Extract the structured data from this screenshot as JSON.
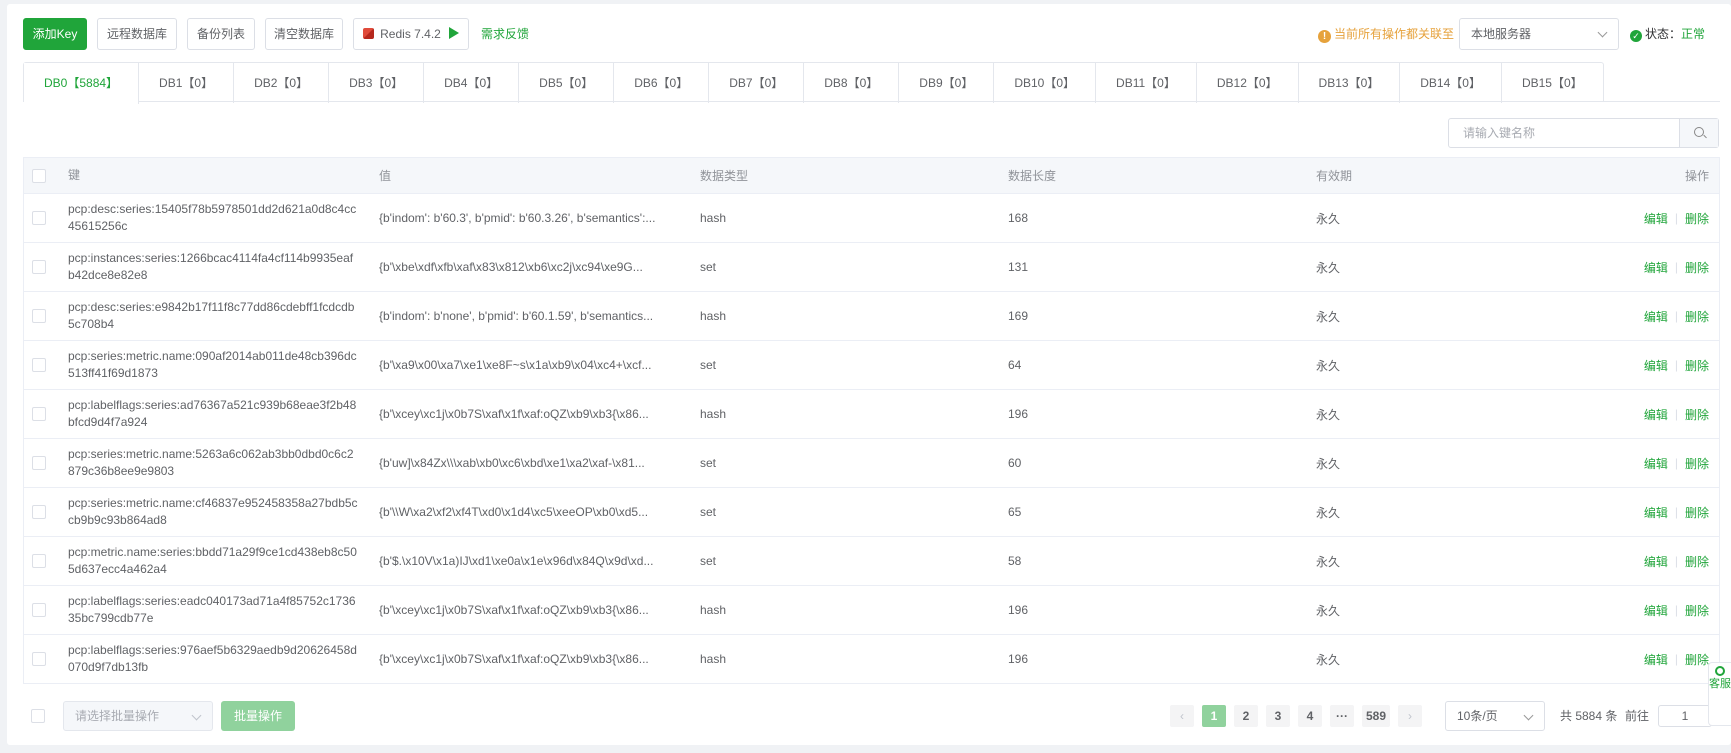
{
  "toolbar": {
    "add_key": "添加Key",
    "remote_db": "远程数据库",
    "backup_list": "备份列表",
    "clear_db": "清空数据库",
    "redis_version": "Redis 7.4.2",
    "feedback": "需求反馈",
    "warning": "当前所有操作都关联至",
    "server_select": "本地服务器",
    "status_label": "状态：",
    "status_value": "正常"
  },
  "tabs": [
    {
      "label": "DB0【5884】",
      "active": true
    },
    {
      "label": "DB1【0】"
    },
    {
      "label": "DB2【0】"
    },
    {
      "label": "DB3【0】"
    },
    {
      "label": "DB4【0】"
    },
    {
      "label": "DB5【0】"
    },
    {
      "label": "DB6【0】"
    },
    {
      "label": "DB7【0】"
    },
    {
      "label": "DB8【0】"
    },
    {
      "label": "DB9【0】"
    },
    {
      "label": "DB10【0】"
    },
    {
      "label": "DB11【0】"
    },
    {
      "label": "DB12【0】"
    },
    {
      "label": "DB13【0】"
    },
    {
      "label": "DB14【0】"
    },
    {
      "label": "DB15【0】"
    }
  ],
  "search": {
    "placeholder": "请输入键名称"
  },
  "table": {
    "headers": {
      "key": "键",
      "value": "值",
      "type": "数据类型",
      "length": "数据长度",
      "expiry": "有效期",
      "ops": "操作"
    },
    "edit_label": "编辑",
    "delete_label": "删除",
    "rows": [
      {
        "key": "pcp:desc:series:15405f78b5978501dd2d621a0d8c4cc45615256c",
        "value": "{b'indom': b'60.3', b'pmid': b'60.3.26', b'semantics':...",
        "type": "hash",
        "length": "168",
        "expiry": "永久"
      },
      {
        "key": "pcp:instances:series:1266bcac4114fa4cf114b9935eafb42dce8e82e8",
        "value": "{b'\\xbe\\xdf\\xfb\\xaf\\x83\\x812\\xb6\\xc2j\\xc94\\xe9G...",
        "type": "set",
        "length": "131",
        "expiry": "永久"
      },
      {
        "key": "pcp:desc:series:e9842b17f11f8c77dd86cdebff1fcdcdb5c708b4",
        "value": "{b'indom': b'none', b'pmid': b'60.1.59', b'semantics...",
        "type": "hash",
        "length": "169",
        "expiry": "永久"
      },
      {
        "key": "pcp:series:metric.name:090af2014ab011de48cb396dc513ff41f69d1873",
        "value": "{b'\\xa9\\x00\\xa7\\xe1\\xe8F~s\\x1a\\xb9\\x04\\xc4+\\xcf...",
        "type": "set",
        "length": "64",
        "expiry": "永久"
      },
      {
        "key": "pcp:labelflags:series:ad76367a521c939b68eae3f2b48bfcd9d4f7a924",
        "value": "{b'\\xcey\\xc1j\\x0b7S\\xaf\\x1f\\xaf:oQZ\\xb9\\xb3{\\x86...",
        "type": "hash",
        "length": "196",
        "expiry": "永久"
      },
      {
        "key": "pcp:series:metric.name:5263a6c062ab3bb0dbd0c6c2879c36b8ee9e9803",
        "value": "{b'uw]\\x84Zx\\\\\\xab\\xb0\\xc6\\xbd\\xe1\\xa2\\xaf-\\x81...",
        "type": "set",
        "length": "60",
        "expiry": "永久"
      },
      {
        "key": "pcp:series:metric.name:cf46837e952458358a27bdb5ccb9b9c93b864ad8",
        "value": "{b'\\\\W\\xa2\\xf2\\xf4T\\xd0\\x1d4\\xc5\\xeeOP\\xb0\\xd5...",
        "type": "set",
        "length": "65",
        "expiry": "永久"
      },
      {
        "key": "pcp:metric.name:series:bbdd71a29f9ce1cd438eb8c505d637ecc4a462a4",
        "value": "{b'$.\\x10V\\x1a)IJ\\xd1\\xe0a\\x1e\\x96d\\x84Q\\x9d\\xd...",
        "type": "set",
        "length": "58",
        "expiry": "永久"
      },
      {
        "key": "pcp:labelflags:series:eadc040173ad71a4f85752c173635bc799cdb77e",
        "value": "{b'\\xcey\\xc1j\\x0b7S\\xaf\\x1f\\xaf:oQZ\\xb9\\xb3{\\x86...",
        "type": "hash",
        "length": "196",
        "expiry": "永久"
      },
      {
        "key": "pcp:labelflags:series:976aef5b6329aedb9d20626458d070d9f7db13fb",
        "value": "{b'\\xcey\\xc1j\\x0b7S\\xaf\\x1f\\xaf:oQZ\\xb9\\xb3{\\x86...",
        "type": "hash",
        "length": "196",
        "expiry": "永久"
      }
    ]
  },
  "footer": {
    "batch_placeholder": "请选择批量操作",
    "batch_button": "批量操作",
    "pages": [
      "1",
      "2",
      "3",
      "4",
      "···",
      "589"
    ],
    "active_page": "1",
    "page_size": "10条/页",
    "total": "共 5884 条",
    "goto_label": "前往",
    "goto_value": "1"
  },
  "side_widget": {
    "label": "客服"
  },
  "colors": {
    "primary": "#20a53a",
    "warning": "#e6a23c"
  }
}
